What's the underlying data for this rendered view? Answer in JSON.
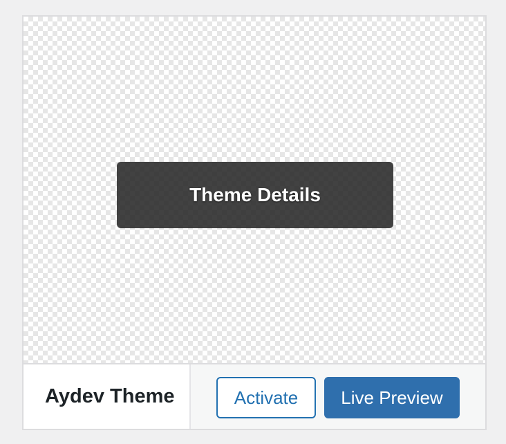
{
  "theme": {
    "name": "Aydev Theme",
    "details_label": "Theme Details"
  },
  "actions": {
    "activate_label": "Activate",
    "live_preview_label": "Live Preview"
  },
  "colors": {
    "primary": "#2271b1",
    "primary_button_bg": "#2f6fad",
    "overlay": "#282828",
    "text_dark": "#1d2327",
    "border": "#dcdcde",
    "footer_bg": "#f6f7f7"
  }
}
